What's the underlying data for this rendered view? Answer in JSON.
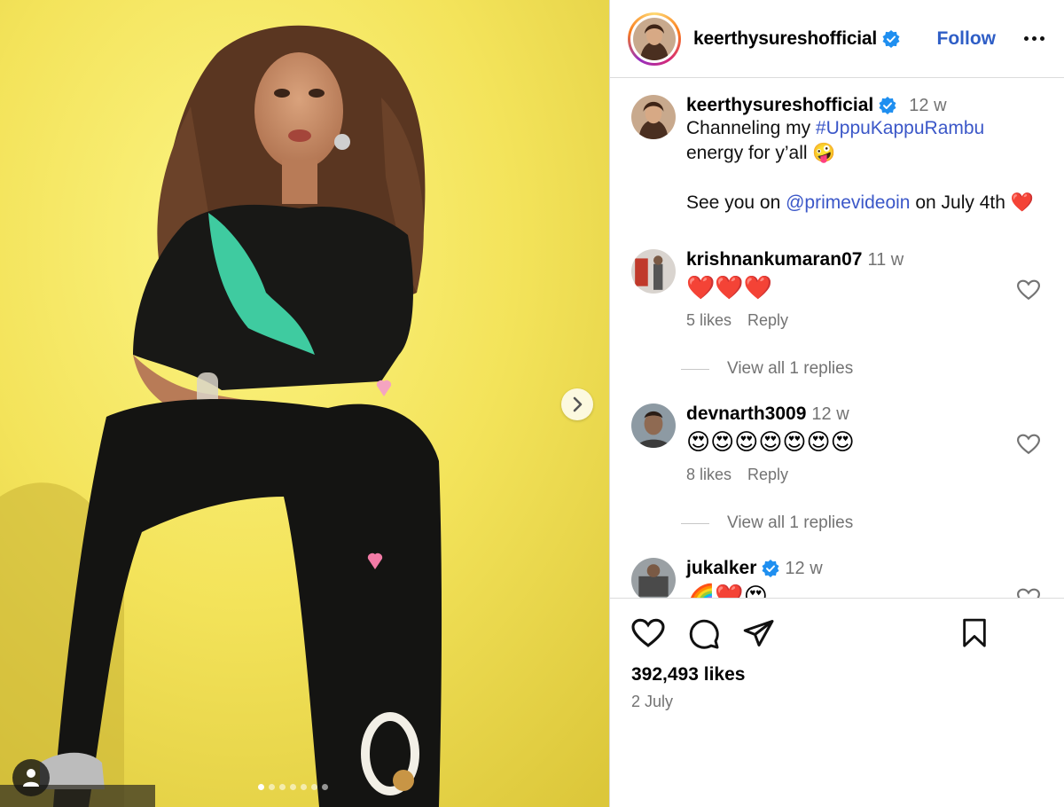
{
  "post": {
    "author": "keerthysureshofficial",
    "follow_label": "Follow",
    "caption": {
      "username": "keerthysureshofficial",
      "time": "12 w",
      "line1_prefix": "Channeling my ",
      "hashtag": "#UppuKappuRambu",
      "line2": "energy for y’all 🤪",
      "line3_prefix": "See you on ",
      "mention": "@primevideoin",
      "line3_suffix": " on July 4th ❤️"
    },
    "comments": [
      {
        "username": "krishnankumaran07",
        "time": "11 w",
        "text": "❤️❤️❤️",
        "likes": "5 likes",
        "reply": "Reply",
        "view_replies": "View all 1 replies"
      },
      {
        "username": "devnarth3009",
        "time": "12 w",
        "text": "😍😍😍😍😍😍😍",
        "likes": "8 likes",
        "reply": "Reply",
        "view_replies": "View all 1 replies"
      },
      {
        "username": "jukalker",
        "time": "12 w",
        "text": "🌈❤️😍"
      }
    ],
    "likes_count": "392,493 likes",
    "date": "2 July",
    "carousel": {
      "slides": 7,
      "active_index": 0
    }
  },
  "icons": {
    "like": "heart-icon",
    "comment": "comment-icon",
    "share": "share-icon",
    "save": "bookmark-icon",
    "more": "more-icon",
    "next": "chevron-right-icon",
    "tags": "user-tag-icon",
    "verified": "verified-badge-icon"
  },
  "colors": {
    "link": "#3b57c8",
    "follow": "#2f5ec6",
    "verified": "#1f8ff0",
    "photo_background": "#f3e55c"
  }
}
